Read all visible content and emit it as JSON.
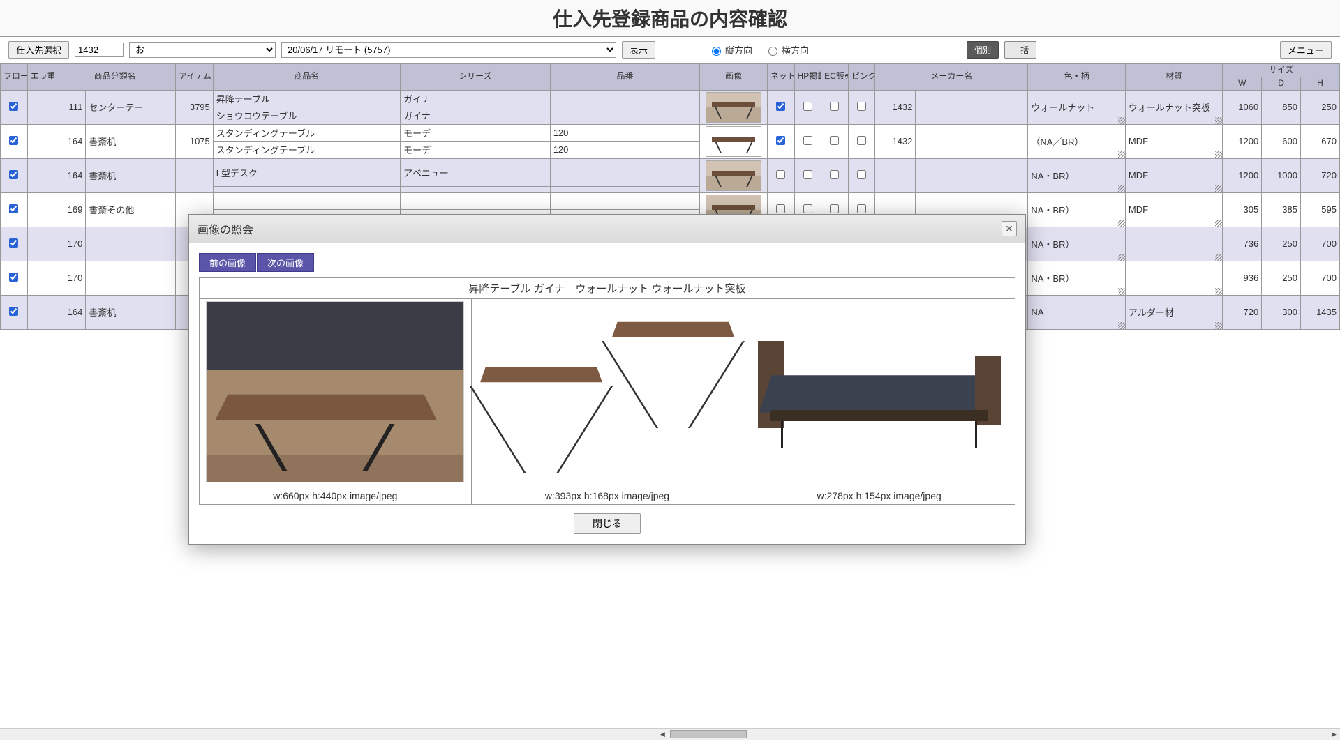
{
  "title": "仕入先登録商品の内容確認",
  "toolbar": {
    "supplier_select": "仕入先選択",
    "code": "1432",
    "supplier_name": "お",
    "session": "20/06/17 リモート (5757)",
    "show": "表示",
    "dir_v": "縦方向",
    "dir_h": "横方向",
    "mode_indiv": "個別",
    "mode_batch": "一括",
    "menu": "メニュー"
  },
  "headers": {
    "flow": "フロー対象",
    "dup": "エラ重複",
    "cat": "商品分類名",
    "item": "アイテム",
    "name": "商品名",
    "series": "シリーズ",
    "model": "品番",
    "img": "画像",
    "net": "ネット掲載",
    "hp": "HP掲載",
    "ec": "EC販売",
    "disc": "ピンク廃番",
    "maker": "メーカー名",
    "color": "色・柄",
    "material": "材質",
    "size": "サイズ",
    "w": "W",
    "d": "D",
    "h": "H"
  },
  "rows": [
    {
      "cat_code": "111",
      "cat": "センターテー",
      "item": "3795",
      "name1": "昇降テーブル",
      "series1": "ガイナ",
      "model1": "",
      "name2": "ショウコウテーブル",
      "series2": "ガイナ",
      "model2": "",
      "maker_code": "1432",
      "maker": "",
      "color": "ウォールナット",
      "material": "ウォールナット突板",
      "w": "1060",
      "d": "850",
      "h": "250",
      "net": true
    },
    {
      "cat_code": "164",
      "cat": "書斎机",
      "item": "1075",
      "name1": "スタンディングテーブル",
      "series1": "モーデ",
      "model1": "120",
      "name2": "スタンディングテーブル",
      "series2": "モーデ",
      "model2": "120",
      "maker_code": "1432",
      "maker": "",
      "color": "（NA／BR）",
      "material": "MDF",
      "w": "1200",
      "d": "600",
      "h": "670",
      "net": true
    },
    {
      "cat_code": "164",
      "cat": "書斎机",
      "item": "",
      "name1": "L型デスク",
      "series1": "アベニュー",
      "model1": "",
      "name2": "",
      "series2": "",
      "model2": "",
      "maker_code": "",
      "maker": "",
      "color": "NA・BR）",
      "material": "MDF",
      "w": "1200",
      "d": "1000",
      "h": "720",
      "net": false
    },
    {
      "cat_code": "169",
      "cat": "書斎その他",
      "item": "",
      "name1": "",
      "series1": "",
      "model1": "",
      "name2": "",
      "series2": "",
      "model2": "",
      "maker_code": "",
      "maker": "",
      "color": "NA・BR）",
      "material": "MDF",
      "w": "305",
      "d": "385",
      "h": "595",
      "net": false
    },
    {
      "cat_code": "170",
      "cat": "",
      "item": "",
      "name1": "",
      "series1": "",
      "model1": "",
      "name2": "",
      "series2": "",
      "model2": "",
      "maker_code": "",
      "maker": "",
      "color": "NA・BR）",
      "material": "",
      "w": "736",
      "d": "250",
      "h": "700",
      "net": false
    },
    {
      "cat_code": "170",
      "cat": "",
      "item": "",
      "name1": "",
      "series1": "",
      "model1": "",
      "name2": "",
      "series2": "",
      "model2": "",
      "maker_code": "",
      "maker": "",
      "color": "NA・BR）",
      "material": "",
      "w": "936",
      "d": "250",
      "h": "700",
      "net": false
    },
    {
      "cat_code": "164",
      "cat": "書斎机",
      "item": "",
      "name1": "",
      "series1": "",
      "model1": "",
      "name2": "",
      "series2": "",
      "model2": "",
      "maker_code": "",
      "maker": "",
      "color": "NA",
      "material": "アルダー材",
      "w": "720",
      "d": "300",
      "h": "1435",
      "net": false
    }
  ],
  "dialog": {
    "title": "画像の照会",
    "prev": "前の画像",
    "next": "次の画像",
    "caption": "昇降テーブル ガイナ　ウォールナット ウォールナット突板",
    "close": "閉じる",
    "images": [
      {
        "meta": "w:660px  h:440px  image/jpeg"
      },
      {
        "meta": "w:393px  h:168px  image/jpeg"
      },
      {
        "meta": "w:278px  h:154px  image/jpeg"
      }
    ]
  }
}
